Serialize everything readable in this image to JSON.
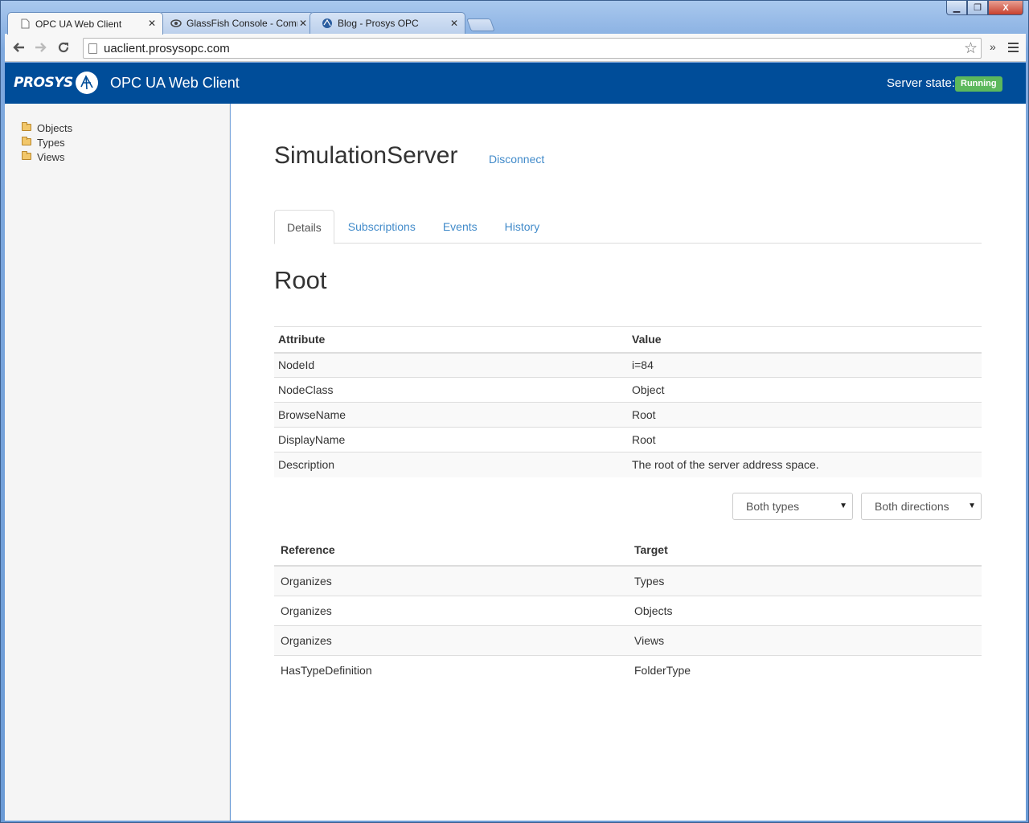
{
  "browser": {
    "tabs": [
      {
        "title": "OPC UA Web Client",
        "icon": "page-icon"
      },
      {
        "title": "GlassFish Console - Comm",
        "icon": "glassfish-icon"
      },
      {
        "title": "Blog - Prosys OPC",
        "icon": "prosys-icon"
      }
    ],
    "url": "uaclient.prosysopc.com",
    "window_controls": {
      "minimize": "▁",
      "maximize": "❐",
      "close": "X"
    }
  },
  "header": {
    "logo_text": "PROSYS",
    "app_title": "OPC UA Web Client",
    "server_state_label": "Server state:",
    "server_state_value": "Running",
    "colors": {
      "bar": "#004d99",
      "badge": "#5cb85c",
      "link": "#428bca"
    }
  },
  "sidebar": {
    "items": [
      {
        "label": "Objects",
        "icon": "folder-icon"
      },
      {
        "label": "Types",
        "icon": "folder-icon"
      },
      {
        "label": "Views",
        "icon": "folder-icon"
      }
    ]
  },
  "main": {
    "server_name": "SimulationServer",
    "disconnect_label": "Disconnect",
    "tabs": [
      {
        "label": "Details",
        "active": true
      },
      {
        "label": "Subscriptions",
        "active": false
      },
      {
        "label": "Events",
        "active": false
      },
      {
        "label": "History",
        "active": false
      }
    ],
    "node_title": "Root",
    "attributes": {
      "headers": [
        "Attribute",
        "Value"
      ],
      "rows": [
        [
          "NodeId",
          "i=84"
        ],
        [
          "NodeClass",
          "Object"
        ],
        [
          "BrowseName",
          "Root"
        ],
        [
          "DisplayName",
          "Root"
        ],
        [
          "Description",
          "The root of the server address space."
        ]
      ]
    },
    "filters": {
      "type_selected": "Both types",
      "direction_selected": "Both directions"
    },
    "references": {
      "headers": [
        "Reference",
        "Target"
      ],
      "rows": [
        [
          "Organizes",
          "Types"
        ],
        [
          "Organizes",
          "Objects"
        ],
        [
          "Organizes",
          "Views"
        ],
        [
          "HasTypeDefinition",
          "FolderType"
        ]
      ]
    }
  }
}
